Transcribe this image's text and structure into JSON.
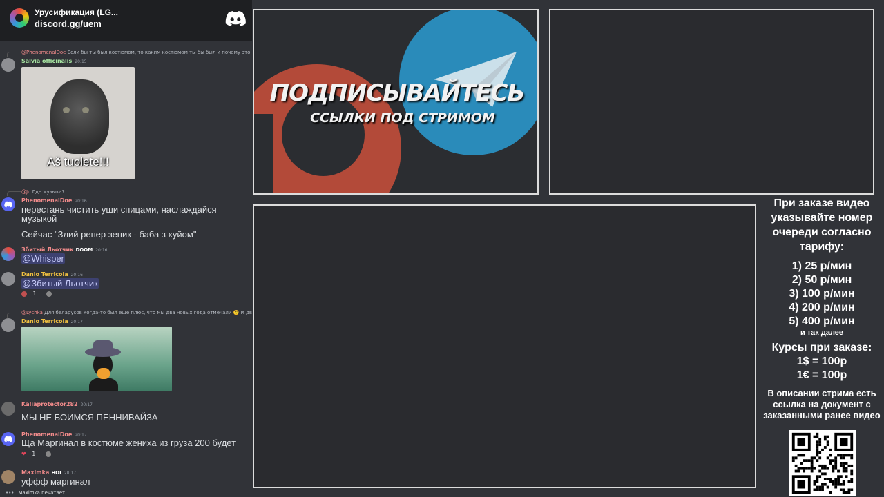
{
  "discord": {
    "server_name": "Урусификация (LG...",
    "invite": "discord.gg/uem",
    "messages": [
      {
        "reply": {
          "name": "@PhenomenalDoe",
          "text": "Если бы ты был костюмом, то каким костюмом ты бы был и почему это был б..."
        },
        "user": "Salvia officinalis",
        "user_color": "#a6e3a1",
        "time": "20:15",
        "gif_caption": "Aš tuolete!!!"
      },
      {
        "reply": {
          "name": "@Ju",
          "text": "Где музыка?"
        },
        "user": "PhenomenalDoe",
        "user_color": "#f28b8b",
        "time": "20:16",
        "lines": [
          "перестань чистить уши спицами, наслаждайся музыкой",
          "Сейчас \"Злий репер зеник - баба з хуйом\""
        ]
      },
      {
        "user": "Збитый Льотчик",
        "user_color": "#f28b8b",
        "badge": "DOOM",
        "time": "20:16",
        "mention": "@Whisper"
      },
      {
        "user": "Danio Terricola",
        "user_color": "#f0c040",
        "time": "20:16",
        "mention": "@Збитый Льотчик",
        "reaction_count": "1"
      },
      {
        "reply": {
          "name": "@Lychka",
          "text": "Для беларусов когда-то был еще плюс, что мы два новых года отмечали 🙂 И двух дн..."
        },
        "user": "Danio Terricola",
        "user_color": "#f0c040",
        "time": "20:17"
      },
      {
        "user": "Kaliaprotector282",
        "user_color": "#f28b8b",
        "time": "20:17",
        "text": "МЫ НЕ БОИМСЯ ПЕННИВАЙЗА"
      },
      {
        "user": "PhenomenalDoe",
        "user_color": "#f28b8b",
        "time": "20:17",
        "text": "Ща Маргинал в костюме жениха из груза 200 будет",
        "reaction_count": "1"
      },
      {
        "user": "Maximka",
        "user_color": "#f28b8b",
        "badge": "HOI",
        "time": "20:17",
        "text": "уффф маргинал"
      }
    ],
    "typing": "Maximka печатает..."
  },
  "promo": {
    "title": "ПОДПИСЫВАЙТЕСЬ",
    "subtitle": "ССЫЛКИ ПОД СТРИМОМ"
  },
  "info": {
    "intro": "При заказе видео указывайте номер очереди согласно тарифу:",
    "tariffs": [
      "1) 25 р/мин",
      "2) 50 р/мин",
      "3) 100 р/мин",
      "4) 200 р/мин",
      "5) 400 р/мин"
    ],
    "tariff_more": "и так далее",
    "rates_title": "Курсы при заказе:",
    "rates": [
      "1$ = 100р",
      "1€ = 100р"
    ],
    "docs_note": "В описании стрима есть ссылка на документ с заказанными ранее видео"
  },
  "colors": {
    "frame_border": "#dcdcdc",
    "discord_blurple": "#5865f2",
    "patreon": "#e2543c",
    "telegram": "#2aa2dd"
  },
  "icons": [
    "discord-logo-icon",
    "patreon-logo-icon",
    "telegram-logo-icon",
    "qr-code-icon"
  ]
}
